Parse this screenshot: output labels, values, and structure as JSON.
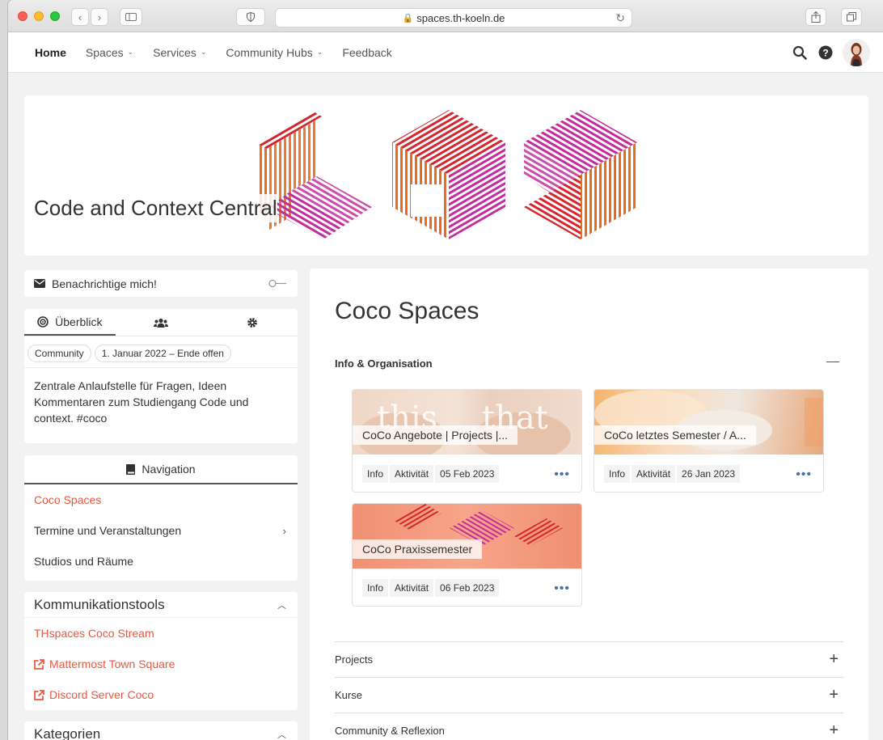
{
  "browser": {
    "url": "spaces.th-koeln.de"
  },
  "topnav": {
    "items": [
      {
        "label": "Home",
        "has_dropdown": false
      },
      {
        "label": "Spaces",
        "has_dropdown": true
      },
      {
        "label": "Services",
        "has_dropdown": true
      },
      {
        "label": "Community Hubs",
        "has_dropdown": true
      },
      {
        "label": "Feedback",
        "has_dropdown": false
      }
    ]
  },
  "banner": {
    "title": "Code and Context Central"
  },
  "sidebar": {
    "notify_label": "Benachrichtige mich!",
    "overview_tab": "Überblick",
    "chips": [
      "Community",
      "1. Januar 2022 – Ende offen"
    ],
    "description": "Zentrale Anlaufstelle für Fragen, Ideen Kommentaren zum Studiengang Code und context. #coco",
    "navigation_label": "Navigation",
    "nav_links": [
      {
        "label": "Coco Spaces",
        "active": true
      },
      {
        "label": "Termine und Veranstaltungen",
        "active": false
      },
      {
        "label": "Studios und Räume",
        "active": false
      }
    ],
    "komm_title": "Kommunikationstools",
    "komm_links": [
      {
        "label": "THspaces Coco Stream",
        "external": false
      },
      {
        "label": "Mattermost Town Square",
        "external": true
      },
      {
        "label": "Discord Server Coco",
        "external": true
      }
    ],
    "kategorien_title": "Kategorien"
  },
  "main": {
    "title": "Coco Spaces",
    "section_title": "Info & Organisation",
    "cards": [
      {
        "title": "CoCo Angebote | Projects |...",
        "tag1": "Info",
        "tag2": "Aktivität",
        "date": "05 Feb 2023"
      },
      {
        "title": "CoCo letztes Semester / A...",
        "tag1": "Info",
        "tag2": "Aktivität",
        "date": "26 Jan 2023"
      },
      {
        "title": "CoCo Praxissemester",
        "tag1": "Info",
        "tag2": "Aktivität",
        "date": "06 Feb 2023"
      }
    ],
    "accordions": [
      "Projects",
      "Kurse",
      "Community & Reflexion"
    ]
  },
  "colors": {
    "accent": "#e9573f",
    "brand_red": "#d4262f",
    "brand_orange": "#ec6a1c",
    "brand_magenta": "#c42c9c"
  }
}
